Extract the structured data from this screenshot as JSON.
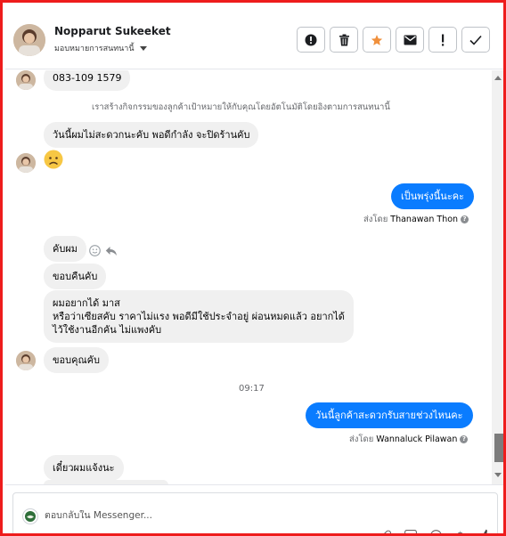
{
  "header": {
    "user_name": "Nopparut Sukeeket",
    "assign_label": "มอบหมายการสนทนานี้",
    "toolbar": [
      "spam-icon",
      "trash-icon",
      "star-icon",
      "mail-icon",
      "alert-icon",
      "check-icon"
    ],
    "accent_star": "#f0903c"
  },
  "messages": {
    "phone": "083-109 1579",
    "system_note": "เราสร้างกิจกรรมของลูกค้าเป้าหมายให้กับคุณโดยอัตโนมัติโดยอิงตามการสนทนานี้",
    "m1": "วันนี้ผมไม่สะดวกนะคับ พอดีกำลัง จะปิดร้านคับ",
    "m2_emoji": "sad-face",
    "out1": "เป็นพรุ่งนี้นะคะ",
    "out1_sent_prefix": "ส่งโดย",
    "out1_sent_by": "Thanawan Thon",
    "m3": "คับผม",
    "m4": "ขอบคืนคับ",
    "m5_line1": "ผมอยากได้ มาส",
    "m5_line2": "หรือว่าเซียสคับ ราคาไม่แรง พอดีมีใช้ประจำอยู่ ผ่อนหมดแล้ว อยากได้",
    "m5_line3": "ไว้ใช้งานอีกคัน ไม่แพงคับ",
    "m6": "ขอบคุณคับ",
    "time": "09:17",
    "out2": "วันนี้ลูกค้าสะดวกรับสายช่วงไหนคะ",
    "out2_sent_prefix": "ส่งโดย",
    "out2_sent_by": "Wannaluck Pilawan",
    "m7": "เดี๋ยวผมแจ้งนะ"
  },
  "composer": {
    "placeholder": "ตอบกลับใน Messenger..."
  },
  "colors": {
    "outgoing": "#0a7cff",
    "incoming": "#f0f0f0",
    "frame": "#ee1c1c"
  }
}
